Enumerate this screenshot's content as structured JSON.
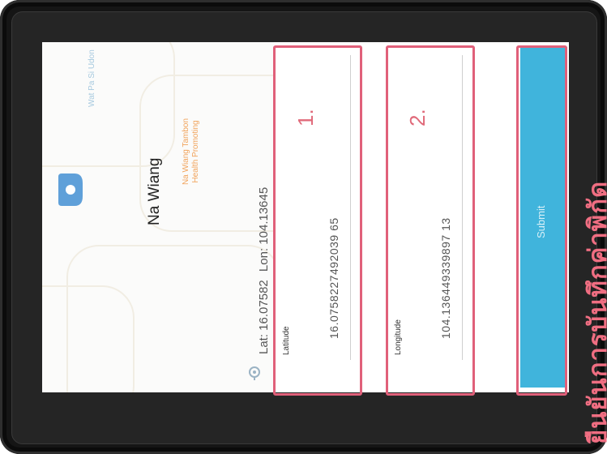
{
  "map": {
    "poi_label": "Wat Pa Si Udon",
    "area_label_line1": "Na Wiang Tambon",
    "area_label_line2": "Health Promoting",
    "pin_icon": "location-pin-icon"
  },
  "place": {
    "name": "Na Wiang"
  },
  "coords": {
    "lat_text": "Lat: 16.07582",
    "lon_text": "Lon: 104.13645",
    "icon": "location-marker-icon"
  },
  "fields": [
    {
      "label": "Latitude",
      "value": "16.0758227492039 65",
      "marker": "1."
    },
    {
      "label": "Longitude",
      "value": "104.136449339897 13",
      "marker": "2."
    }
  ],
  "submit": {
    "label": "Submit"
  },
  "caption": {
    "text": "ยืนยันการบันทึกค่าพิกัด"
  },
  "colors": {
    "accent": "#40b4dc",
    "highlight": "#e0607a",
    "bezel": "#151515"
  }
}
